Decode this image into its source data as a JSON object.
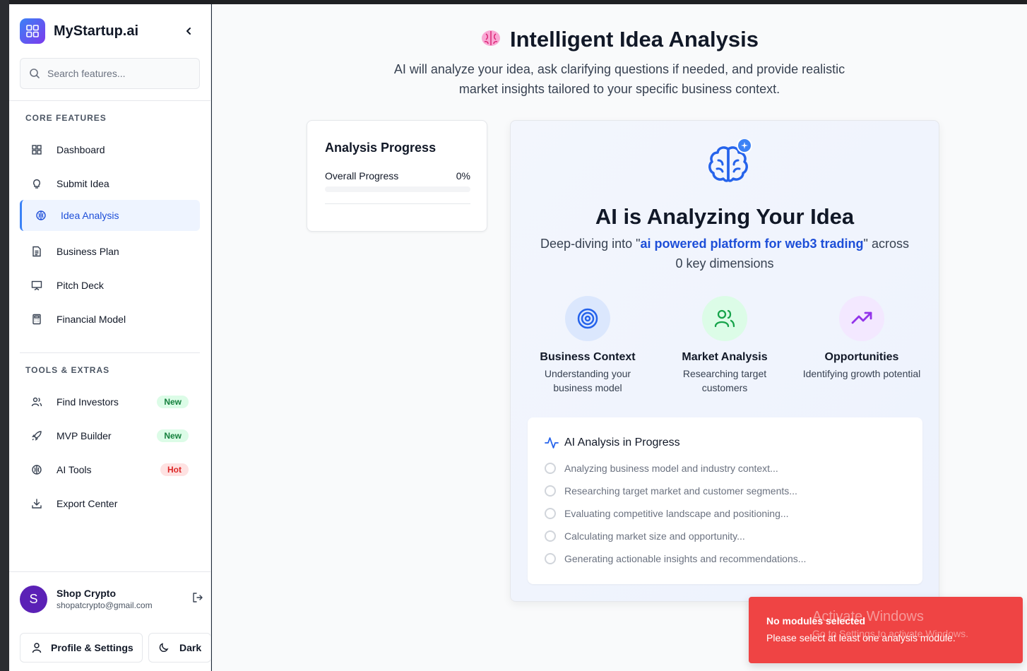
{
  "app": {
    "name": "MyStartup.ai",
    "search_placeholder": "Search features..."
  },
  "sidebar": {
    "core_title": "CORE FEATURES",
    "core_items": [
      {
        "label": "Dashboard",
        "icon": "dashboard-icon"
      },
      {
        "label": "Submit Idea",
        "icon": "lightbulb-icon"
      },
      {
        "label": "Idea Analysis",
        "icon": "brain-icon",
        "active": true
      },
      {
        "label": "Business Plan",
        "icon": "document-icon"
      },
      {
        "label": "Pitch Deck",
        "icon": "presentation-icon"
      },
      {
        "label": "Financial Model",
        "icon": "calculator-icon"
      }
    ],
    "tools_title": "TOOLS & EXTRAS",
    "tools_items": [
      {
        "label": "Find Investors",
        "icon": "users-icon",
        "badge": "New"
      },
      {
        "label": "MVP Builder",
        "icon": "rocket-icon",
        "badge": "New"
      },
      {
        "label": "AI Tools",
        "icon": "brain-icon",
        "badge": "Hot"
      },
      {
        "label": "Export Center",
        "icon": "download-icon"
      }
    ]
  },
  "user": {
    "initial": "S",
    "name": "Shop Crypto",
    "email": "shopatcrypto@gmail.com"
  },
  "footer": {
    "profile_label": "Profile & Settings",
    "theme_label": "Dark"
  },
  "main": {
    "title": "Intelligent Idea Analysis",
    "subtitle": "AI will analyze your idea, ask clarifying questions if needed, and provide realistic market insights tailored to your specific business context."
  },
  "progress": {
    "title": "Analysis Progress",
    "label": "Overall Progress",
    "value_text": "0%",
    "value": 0
  },
  "analysis": {
    "title": "AI is Analyzing Your Idea",
    "sub_prefix": "Deep-diving into \"",
    "idea": "ai powered platform for web3 trading",
    "sub_suffix": "\" across",
    "sub_line2": "0 key dimensions",
    "dimensions": [
      {
        "title": "Business Context",
        "desc": "Understanding your business model",
        "icon": "target-icon",
        "color": "#2563eb"
      },
      {
        "title": "Market Analysis",
        "desc": "Researching target customers",
        "icon": "users-icon",
        "color": "#16a34a"
      },
      {
        "title": "Opportunities",
        "desc": "Identifying growth potential",
        "icon": "trending-up-icon",
        "color": "#9333ea"
      }
    ],
    "steps_title": "AI Analysis in Progress",
    "steps": [
      "Analyzing business model and industry context...",
      "Researching target market and customer segments...",
      "Evaluating competitive landscape and positioning...",
      "Calculating market size and opportunity...",
      "Generating actionable insights and recommendations..."
    ]
  },
  "toast": {
    "title": "No modules selected",
    "message": "Please select at least one analysis module."
  },
  "watermark": {
    "line1": "Activate Windows",
    "line2": "Go to Settings to activate Windows."
  }
}
